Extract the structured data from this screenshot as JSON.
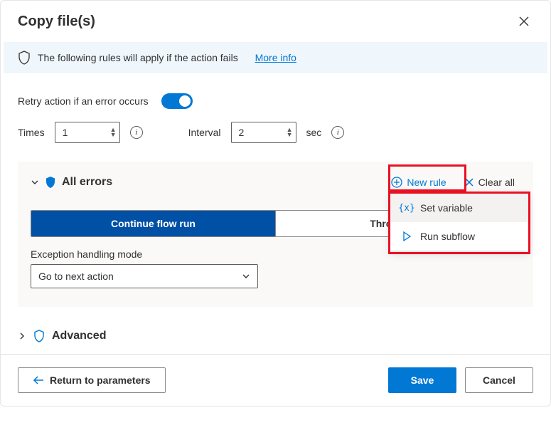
{
  "dialog": {
    "title": "Copy file(s)"
  },
  "infoBar": {
    "text": "The following rules will apply if the action fails",
    "link": "More info"
  },
  "retry": {
    "label": "Retry action if an error occurs",
    "timesLabel": "Times",
    "timesValue": "1",
    "intervalLabel": "Interval",
    "intervalValue": "2",
    "intervalUnit": "sec"
  },
  "allErrors": {
    "title": "All errors",
    "newRule": "New rule",
    "clearAll": "Clear all",
    "menu": {
      "setVariable": "Set variable",
      "runSubflow": "Run subflow"
    },
    "segmented": {
      "continue": "Continue flow run",
      "throw": "Throw error"
    },
    "exceptionLabel": "Exception handling mode",
    "exceptionValue": "Go to next action"
  },
  "advanced": {
    "title": "Advanced"
  },
  "footer": {
    "return": "Return to parameters",
    "save": "Save",
    "cancel": "Cancel"
  }
}
